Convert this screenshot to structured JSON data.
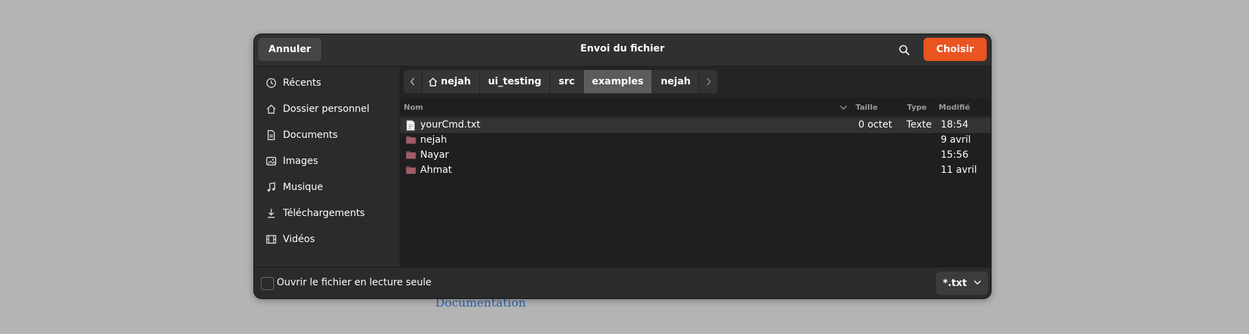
{
  "background": {
    "link_text": "Documentation",
    "link_color": "#2e62ad"
  },
  "dialog": {
    "title": "Envoi du fichier",
    "cancel_label": "Annuler",
    "choose_label": "Choisir",
    "accent_color": "#e95420"
  },
  "sidebar": {
    "items": [
      {
        "label": "Récents",
        "icon": "clock-icon"
      },
      {
        "label": "Dossier personnel",
        "icon": "home-icon"
      },
      {
        "label": "Documents",
        "icon": "document-icon"
      },
      {
        "label": "Images",
        "icon": "image-icon"
      },
      {
        "label": "Musique",
        "icon": "music-icon"
      },
      {
        "label": "Téléchargements",
        "icon": "download-icon"
      },
      {
        "label": "Vidéos",
        "icon": "video-icon"
      }
    ]
  },
  "pathbar": {
    "crumbs": [
      "nejah",
      "ui_testing",
      "src",
      "examples",
      "nejah"
    ],
    "active_index": 3
  },
  "columns": {
    "name": "Nom",
    "size": "Taille",
    "type": "Type",
    "modified": "Modifié"
  },
  "files": [
    {
      "name": "yourCmd.txt",
      "kind": "file",
      "size": "0 octet",
      "type": "Texte",
      "modified": "18:54",
      "selected": true
    },
    {
      "name": "nejah",
      "kind": "folder",
      "size": "",
      "type": "",
      "modified": "9 avril"
    },
    {
      "name": "Nayar",
      "kind": "folder",
      "size": "",
      "type": "",
      "modified": "15:56"
    },
    {
      "name": "Ahmat",
      "kind": "folder",
      "size": "",
      "type": "",
      "modified": "11 avril"
    }
  ],
  "footer": {
    "readonly_label": "Ouvrir le fichier en lecture seule",
    "readonly_checked": false,
    "filter_value": "*.txt"
  }
}
